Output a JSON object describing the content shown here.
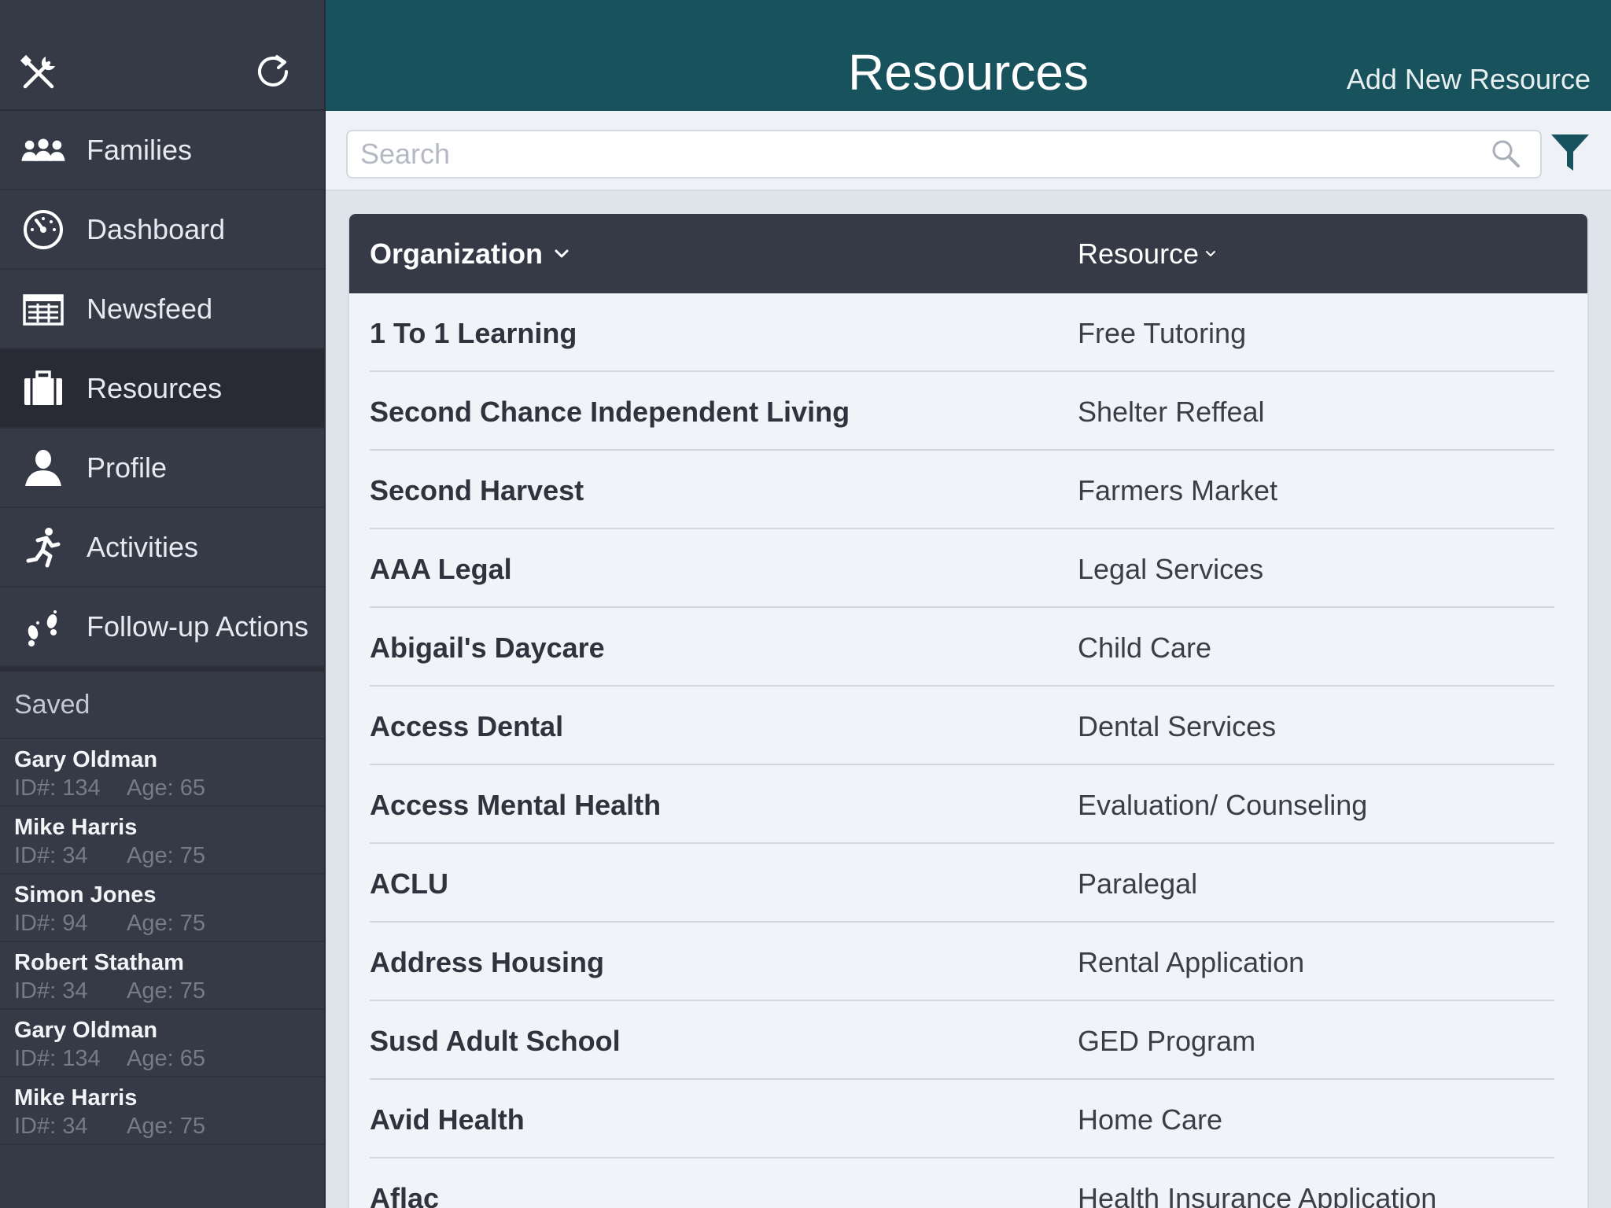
{
  "colors": {
    "sidebar_bg": "#363a47",
    "sidebar_active": "#282b35",
    "header_bg": "#18525d",
    "table_header_bg": "#363a47",
    "row_bg": "#f0f3f7"
  },
  "sidebar": {
    "top_icons": [
      "tools-icon",
      "refresh-icon"
    ],
    "items": [
      {
        "label": "Families",
        "icon": "families-icon"
      },
      {
        "label": "Dashboard",
        "icon": "dashboard-icon"
      },
      {
        "label": "Newsfeed",
        "icon": "newsfeed-icon"
      },
      {
        "label": "Resources",
        "icon": "briefcase-icon",
        "active": true
      },
      {
        "label": "Profile",
        "icon": "profile-icon"
      },
      {
        "label": "Activities",
        "icon": "running-icon"
      },
      {
        "label": "Follow-up Actions",
        "icon": "footprints-icon"
      }
    ],
    "saved_title": "Saved",
    "saved": [
      {
        "name": "Gary Oldman",
        "id": "ID#: 134",
        "age": "Age: 65"
      },
      {
        "name": "Mike Harris",
        "id": "ID#: 34",
        "age": "Age: 75"
      },
      {
        "name": "Simon Jones",
        "id": "ID#: 94",
        "age": "Age: 75"
      },
      {
        "name": "Robert Statham",
        "id": "ID#: 34",
        "age": "Age: 75"
      },
      {
        "name": "Gary Oldman",
        "id": "ID#: 134",
        "age": "Age: 65"
      },
      {
        "name": "Mike Harris",
        "id": "ID#: 34",
        "age": "Age: 75"
      }
    ]
  },
  "header": {
    "title": "Resources",
    "add_label": "Add New Resource"
  },
  "search": {
    "placeholder": "Search",
    "value": ""
  },
  "table": {
    "columns": [
      "Organization",
      "Resource"
    ],
    "sort_icon": "chevron-down-icon",
    "rows": [
      {
        "organization": "1 To 1 Learning",
        "resource": "Free Tutoring"
      },
      {
        "organization": "Second Chance Independent Living",
        "resource": "Shelter Reffeal"
      },
      {
        "organization": "Second Harvest",
        "resource": "Farmers Market"
      },
      {
        "organization": "AAA Legal",
        "resource": "Legal Services"
      },
      {
        "organization": "Abigail's Daycare",
        "resource": "Child Care"
      },
      {
        "organization": "Access Dental",
        "resource": "Dental Services"
      },
      {
        "organization": "Access Mental Health",
        "resource": "Evaluation/ Counseling"
      },
      {
        "organization": "ACLU",
        "resource": "Paralegal"
      },
      {
        "organization": "Address Housing",
        "resource": "Rental Application"
      },
      {
        "organization": "Susd Adult School",
        "resource": "GED Program"
      },
      {
        "organization": "Avid Health",
        "resource": "Home Care"
      },
      {
        "organization": "Aflac",
        "resource": "Health Insurance Application"
      }
    ]
  }
}
